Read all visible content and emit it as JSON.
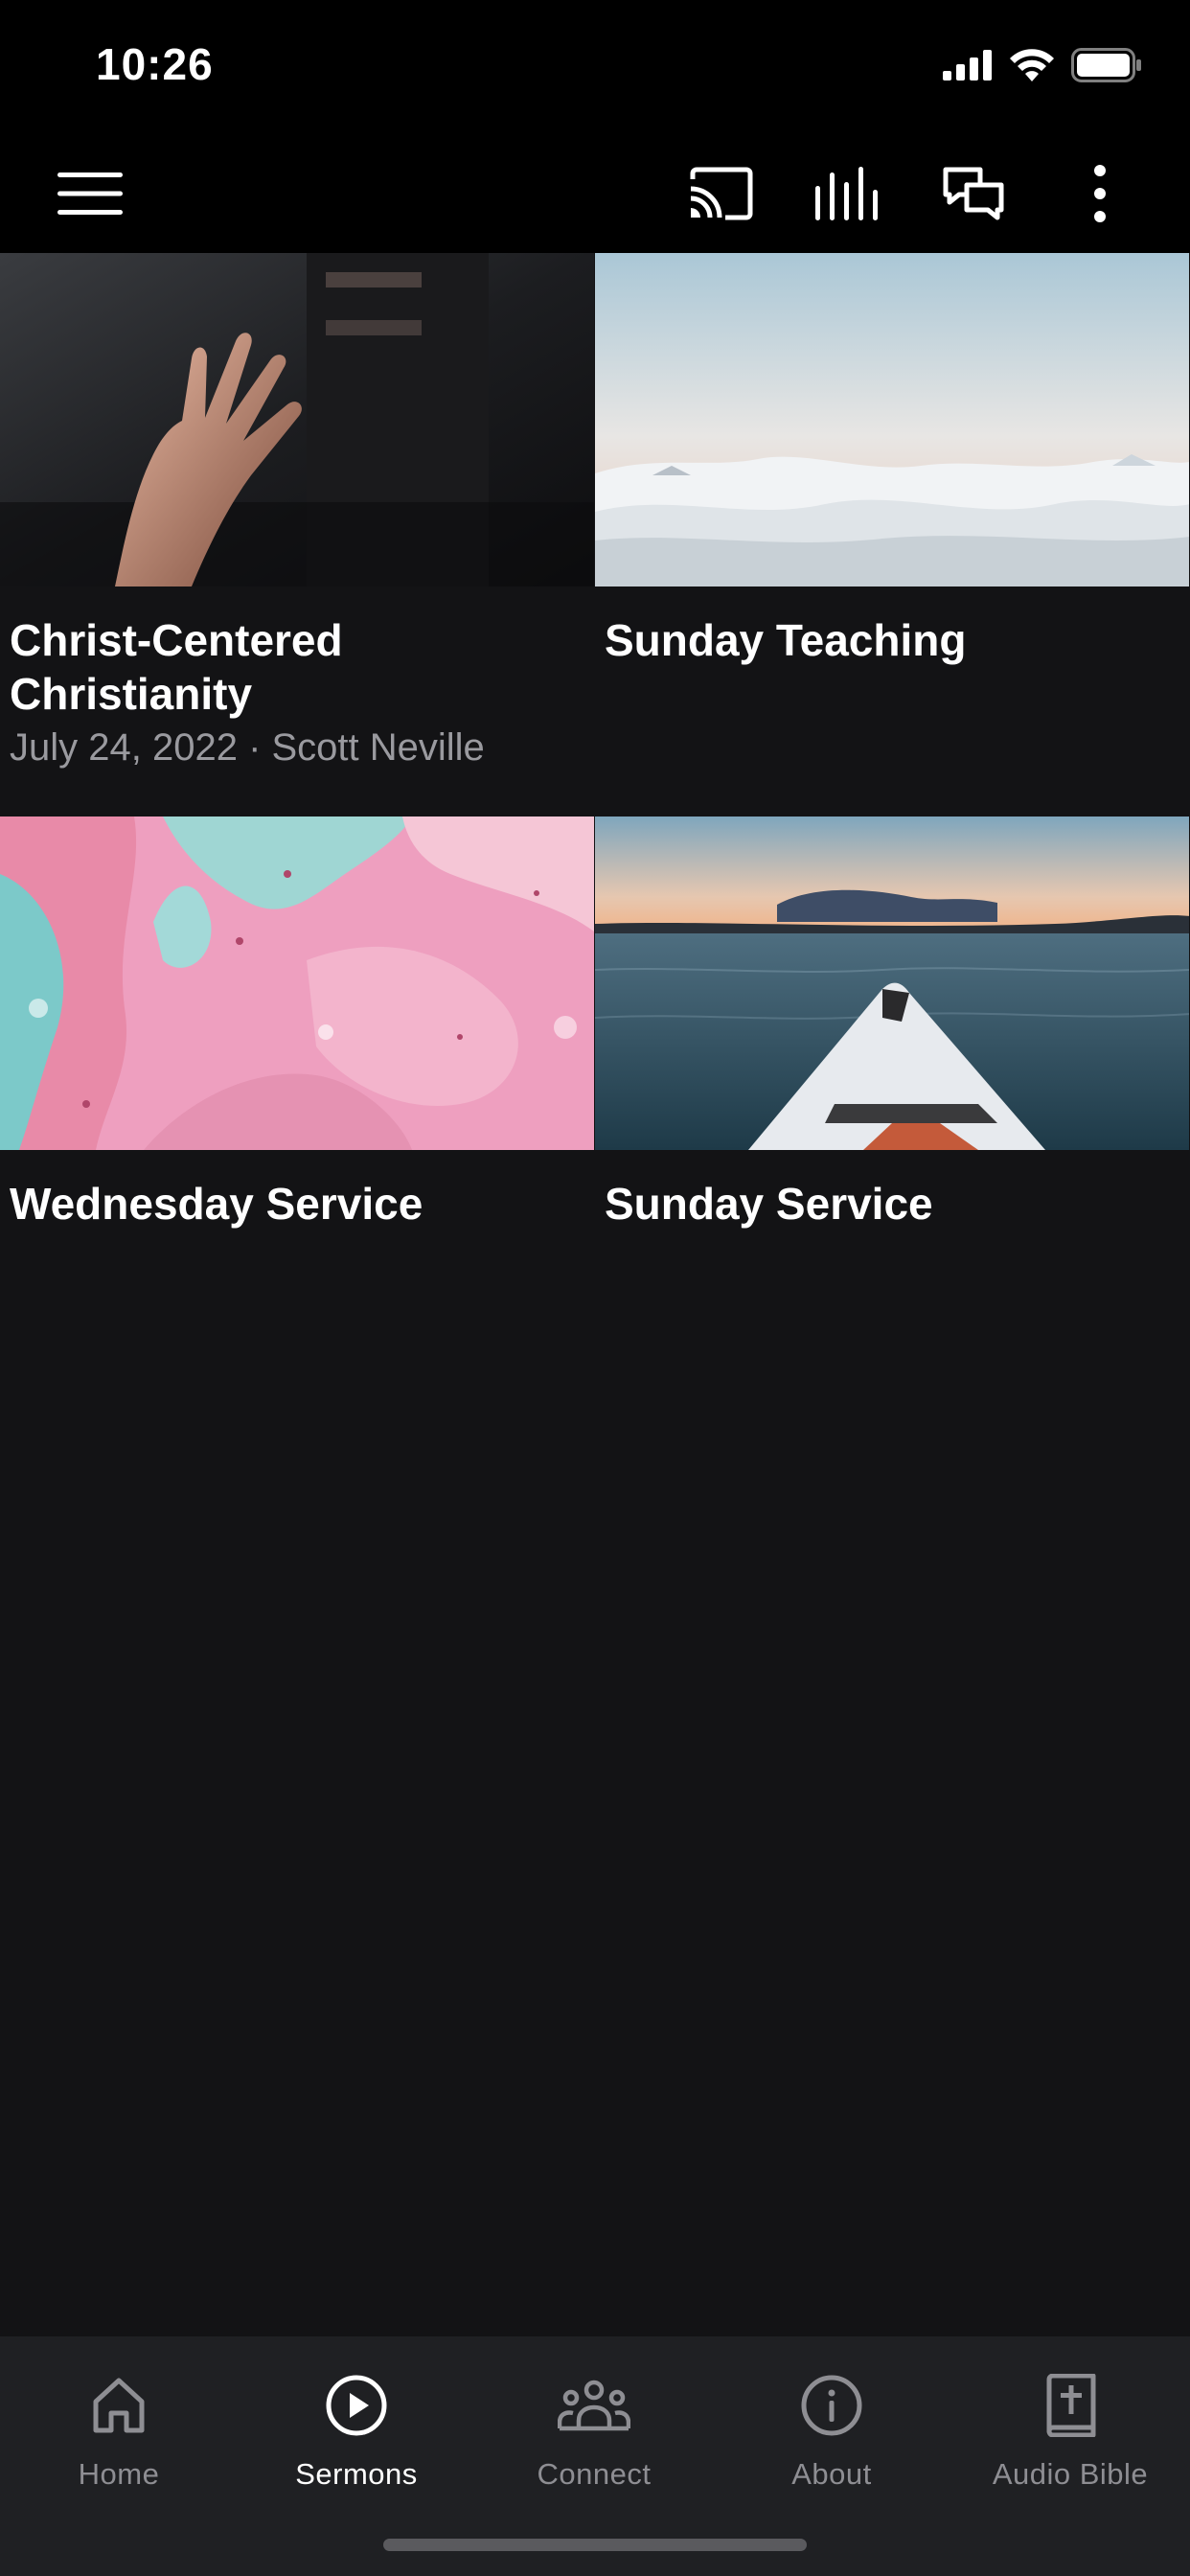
{
  "status_bar": {
    "time": "10:26"
  },
  "toolbar": {
    "menu_icon": "hamburger-menu-icon",
    "actions": [
      "cast-icon",
      "equalizer-icon",
      "chat-icon",
      "more-vertical-icon"
    ]
  },
  "sermons": [
    {
      "title": "Christ-Centered Christianity",
      "meta": "July 24, 2022 · Scott Neville",
      "image": "open-hand-photo"
    },
    {
      "title": "Sunday Teaching",
      "meta": "",
      "image": "clouds-photo"
    },
    {
      "title": "Wednesday Service",
      "meta": "",
      "image": "pink-fluid-art-photo"
    },
    {
      "title": "Sunday Service",
      "meta": "",
      "image": "kayak-on-lake-photo"
    }
  ],
  "bottom_nav": [
    {
      "label": "Home",
      "icon": "home-icon",
      "active": false
    },
    {
      "label": "Sermons",
      "icon": "play-circle-icon",
      "active": true
    },
    {
      "label": "Connect",
      "icon": "people-icon",
      "active": false
    },
    {
      "label": "About",
      "icon": "info-icon",
      "active": false
    },
    {
      "label": "Audio Bible",
      "icon": "bible-icon",
      "active": false
    }
  ],
  "colors": {
    "background": "#131315",
    "bar_background": "#000000",
    "nav_background": "#1f2023",
    "inactive": "#8e8e93",
    "active": "#ffffff",
    "meta_text": "#9a9a9f"
  }
}
